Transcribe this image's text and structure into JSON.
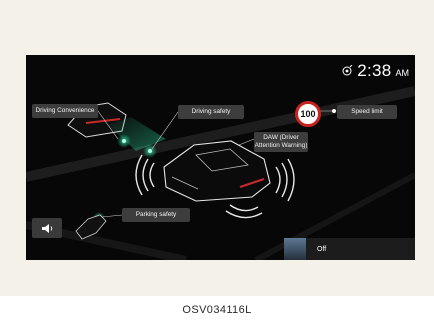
{
  "status": {
    "time": "2:38",
    "ampm": "AM",
    "gps_icon": "gps-signal-icon"
  },
  "labels": {
    "driving_convenience": "Driving Convenience",
    "driving_safety": "Driving safety",
    "daw": "DAW (Driver Attention Warning)",
    "speed_limit": "Speed limit",
    "parking_safety": "Parking safety"
  },
  "speed_sign": {
    "value": "100",
    "ring_color": "#c8231f"
  },
  "volume": {
    "icon": "speaker-icon"
  },
  "bottom_tile": {
    "label": "Off"
  },
  "caption": "OSV034116L",
  "colors": {
    "accent": "#2fd7a0",
    "screen_bg": "#070707",
    "callout_bg": "#3d3d3d",
    "panel_bg": "#f4f1e8"
  }
}
